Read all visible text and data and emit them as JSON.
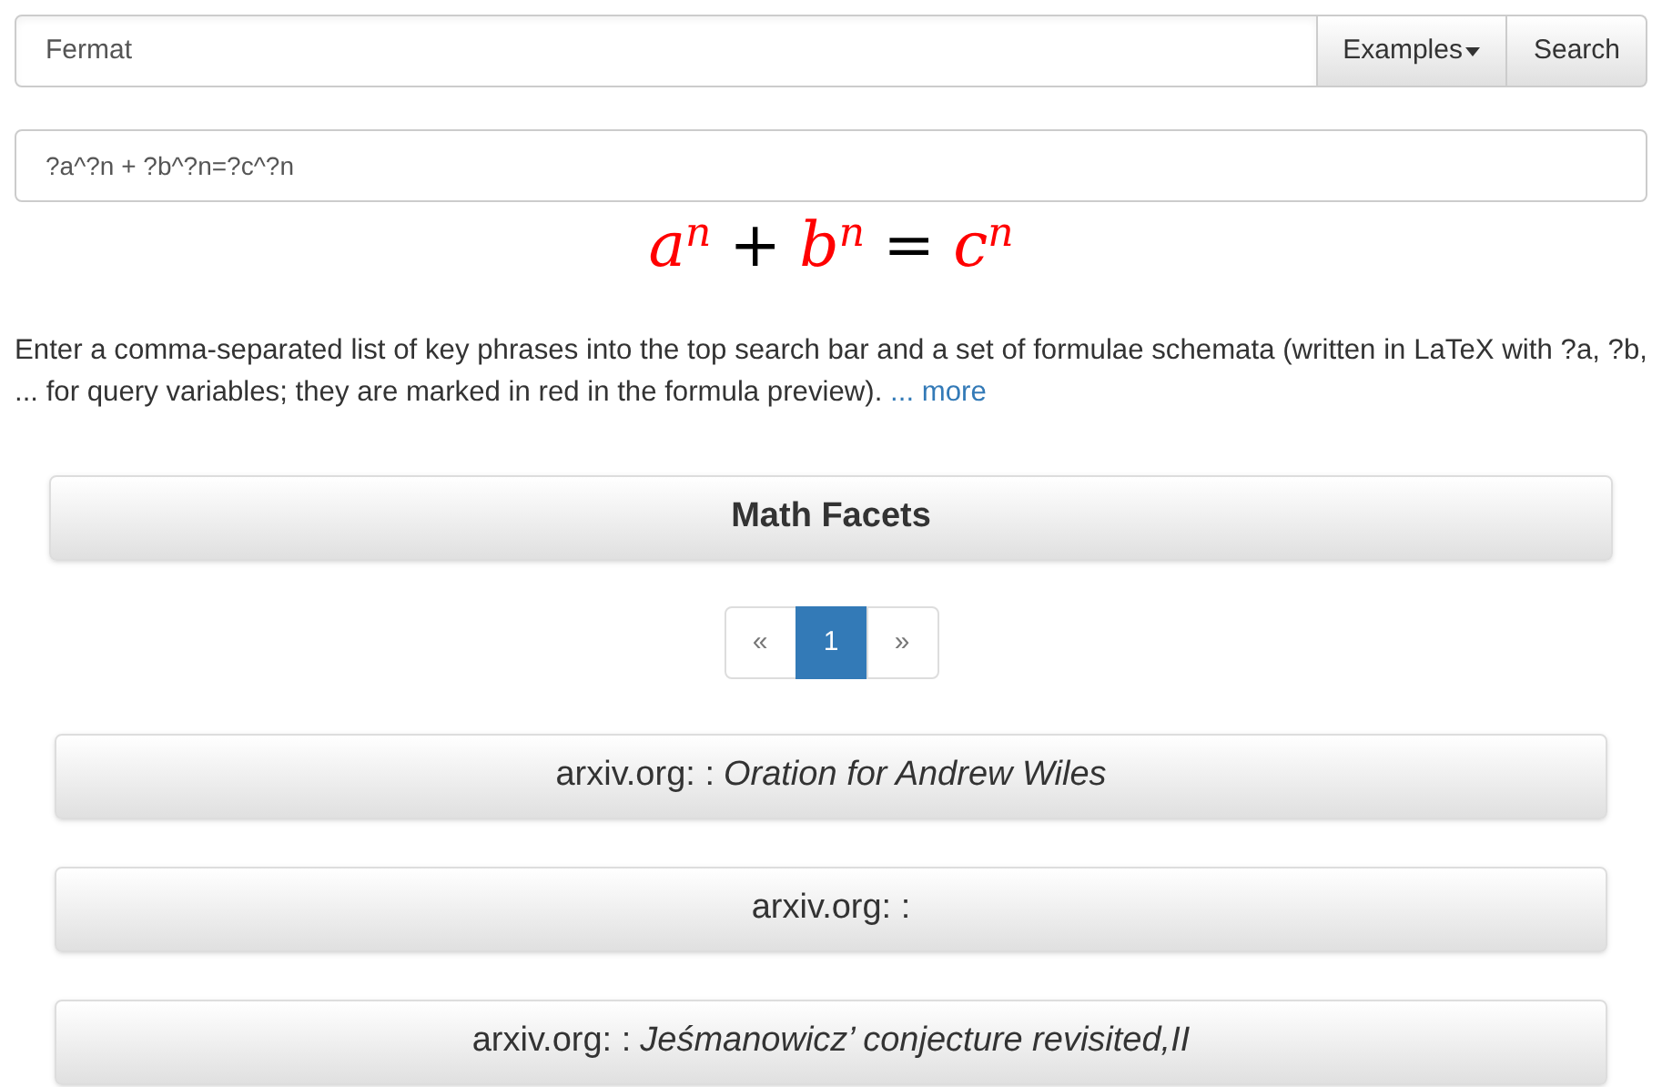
{
  "search": {
    "value": "Fermat",
    "examples_button": "Examples",
    "search_button": "Search"
  },
  "formula_input": {
    "value": "?a^?n + ?b^?n=?c^?n"
  },
  "formula_preview": [
    {
      "kind": "var",
      "base": "a",
      "exponent": "n",
      "query": true
    },
    {
      "kind": "op",
      "text": "+"
    },
    {
      "kind": "var",
      "base": "b",
      "exponent": "n",
      "query": true
    },
    {
      "kind": "op",
      "text": "="
    },
    {
      "kind": "var",
      "base": "c",
      "exponent": "n",
      "query": true
    }
  ],
  "help_text": "Enter a comma-separated list of key phrases into the top search bar and a set of formulae schemata (written in LaTeX with ?a, ?b, ... for query variables; they are marked in red in the formula preview).",
  "help_link": "... more",
  "facets_panel": {
    "title": "Math Facets"
  },
  "pagination": [
    {
      "label": "«",
      "selected": false
    },
    {
      "label": "1",
      "selected": true
    },
    {
      "label": "»",
      "selected": false
    }
  ],
  "results": [
    {
      "source": "arxiv.org: :",
      "title": "Oration for Andrew Wiles"
    },
    {
      "source": "arxiv.org: :"
    },
    {
      "source": "arxiv.org: :",
      "title": "Jeśmanowicz’ conjecture revisited,II"
    }
  ]
}
